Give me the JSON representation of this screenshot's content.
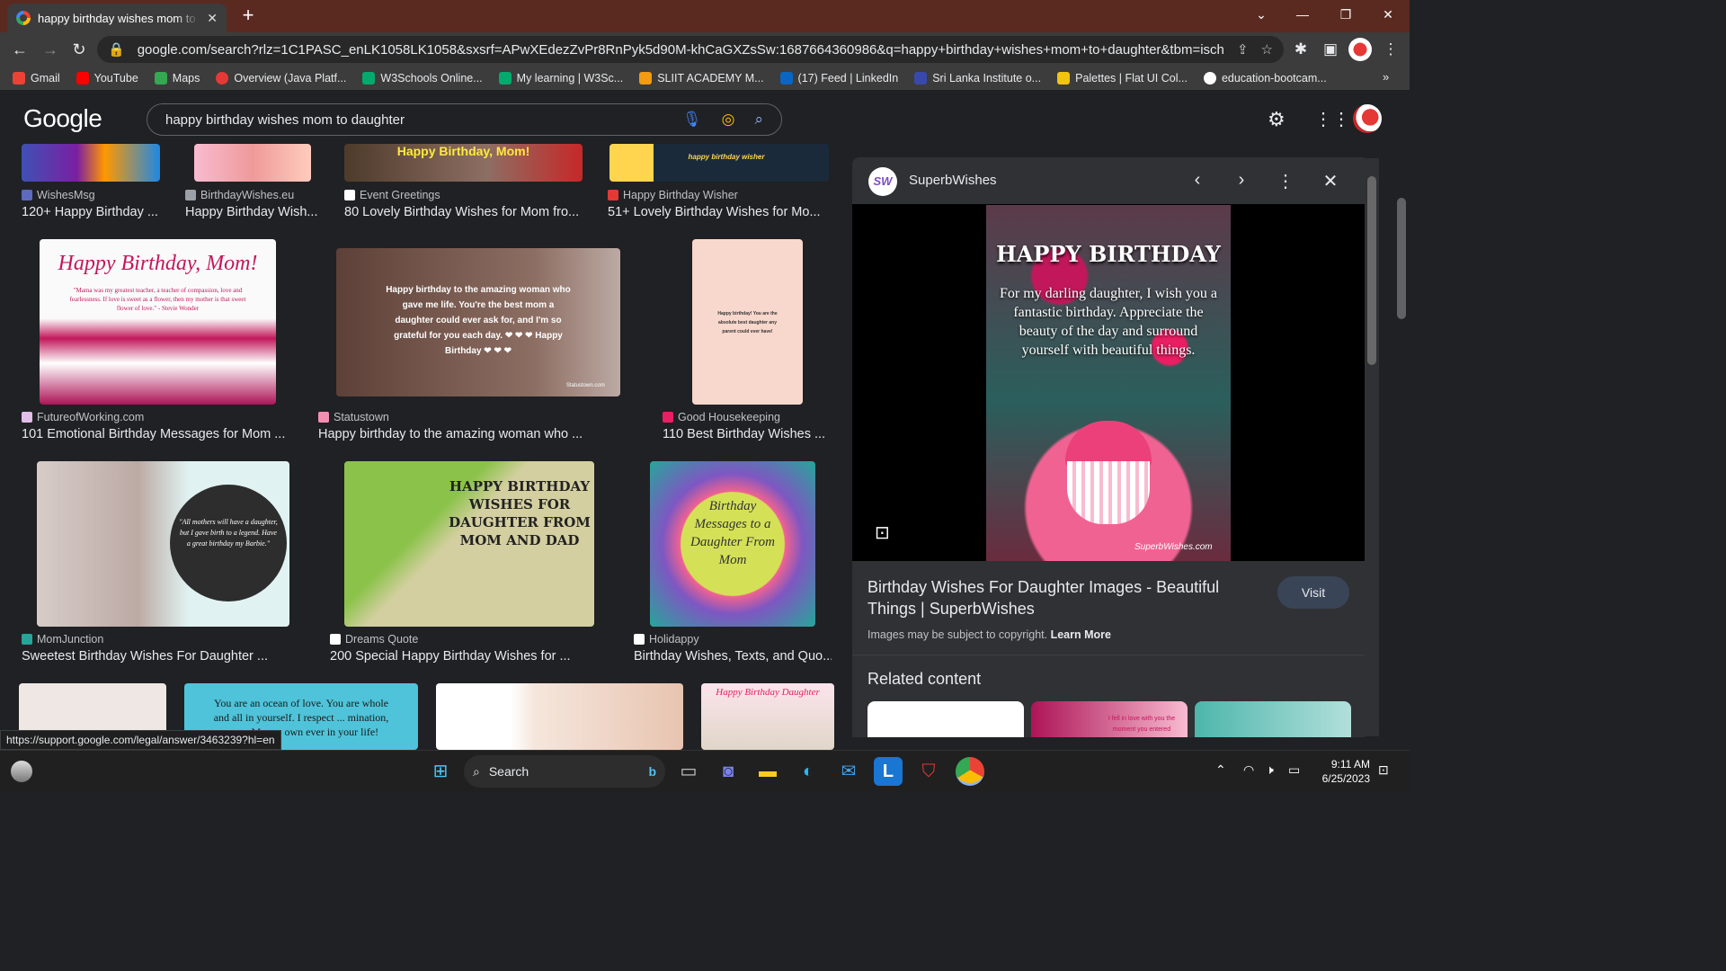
{
  "browser": {
    "tab_title": "happy birthday wishes mom to daughter",
    "tab_close": "✕",
    "new_tab": "+",
    "url": "google.com/search?rlz=1C1PASC_enLK1058LK1058&sxsrf=APwXEdezZvPr8RnPyk5d90M-khCaGXZsSw:1687664360986&q=happy+birthday+wishes+mom+to+daughter&tbm=isch&sa=X&v...",
    "window": {
      "minimize": "—",
      "restore": "❐",
      "close": "✕",
      "dropdown": "⌄"
    }
  },
  "bookmarks": [
    {
      "label": "Gmail",
      "color": "#ea4335"
    },
    {
      "label": "YouTube",
      "color": "#ff0000"
    },
    {
      "label": "Maps",
      "color": "#34a853"
    },
    {
      "label": "Overview (Java Platf...",
      "color": "#e53935"
    },
    {
      "label": "W3Schools Online...",
      "color": "#04aa6d"
    },
    {
      "label": "My learning | W3Sc...",
      "color": "#04aa6d"
    },
    {
      "label": "SLIIT ACADEMY M...",
      "color": "#f39c12"
    },
    {
      "label": "(17) Feed | LinkedIn",
      "color": "#0a66c2"
    },
    {
      "label": "Sri Lanka Institute o...",
      "color": "#3949ab"
    },
    {
      "label": "Palettes | Flat UI Col...",
      "color": "#f1c40f"
    },
    {
      "label": "education-bootcam...",
      "color": "#ffffff"
    }
  ],
  "google": {
    "logo": "Google",
    "query": "happy birthday wishes mom to daughter"
  },
  "results": [
    {
      "source": "WishesMsg",
      "title": "120+ Happy Birthday ...",
      "src_color": "#5c6bc0"
    },
    {
      "source": "BirthdayWishes.eu",
      "title": "Happy Birthday Wish...",
      "src_color": "#9aa0a6"
    },
    {
      "source": "Event Greetings",
      "title": "80 Lovely Birthday Wishes for Mom fro...",
      "src_color": "#ffffff",
      "caption": "Happy Birthday, Mom!"
    },
    {
      "source": "Happy Birthday Wisher",
      "title": "51+ Lovely Birthday Wishes for Mo...",
      "src_color": "#e53935",
      "caption": "happy birthday wisher"
    },
    {
      "source": "FutureofWorking.com",
      "title": "101 Emotional Birthday Messages for Mom ...",
      "src_color": "#e1bee7",
      "caption": "Happy Birthday, Mom!",
      "quote": "\"Mama was my greatest teacher, a teacher of compassion, love and fearlessness. If love is sweet as a flower, then my mother is that sweet flower of love.\" - Stevie Wonder"
    },
    {
      "source": "Statustown",
      "title": "Happy birthday to the amazing woman who ...",
      "src_color": "#f48fb1",
      "caption": "Happy birthday to the amazing woman who gave me life. You're the best mom a daughter could ever ask for, and I'm so grateful for you each day. ❤ ❤ ❤ Happy Birthday ❤ ❤ ❤",
      "wm": "Statustown.com"
    },
    {
      "source": "Good Housekeeping",
      "title": "110 Best Birthday Wishes ...",
      "src_color": "#e91e63",
      "caption": "Happy birthday! You are the absolute best daughter any parent could ever have!"
    },
    {
      "source": "MomJunction",
      "title": "Sweetest Birthday Wishes For Daughter ...",
      "src_color": "#26a69a",
      "caption": "\"All mothers will have a daughter, but I gave birth to a legend. Have a great birthday my Barbie.\""
    },
    {
      "source": "Dreams Quote",
      "title": "200 Special Happy Birthday Wishes for ...",
      "src_color": "#ffffff",
      "caption": "HAPPY BIRTHDAY WISHES FOR DAUGHTER FROM MOM AND DAD"
    },
    {
      "source": "Holidappy",
      "title": "Birthday Wishes, Texts, and Quo...",
      "src_color": "#ffffff",
      "caption": "Birthday Messages to a Daughter From Mom"
    }
  ],
  "row4": {
    "b_caption": "You are an ocean of love. You are whole and all in yourself. I respect ... mination, mom. May ... own ever in your life!",
    "d_caption": "Happy Birthday Daughter"
  },
  "panel": {
    "site": "SuperbWishes",
    "logo_text": "SW",
    "image_title": "HAPPY BIRTHDAY",
    "image_message": "For my darling daughter, I wish you a fantastic birthday. Appreciate the beauty of the day and surround yourself with beautiful things.",
    "image_watermark": "SuperbWishes.com",
    "title": "Birthday Wishes For Daughter Images - Beautiful Things | SuperbWishes",
    "visit": "Visit",
    "copyright": "Images may be subject to copyright.",
    "learn_more": "Learn More",
    "related": "Related content",
    "related_caption": "I fell in love with you the moment you entered"
  },
  "status_url": "https://support.google.com/legal/answer/3463239?hl=en",
  "taskbar": {
    "search": "Search",
    "time": "9:11 AM",
    "date": "6/25/2023"
  }
}
